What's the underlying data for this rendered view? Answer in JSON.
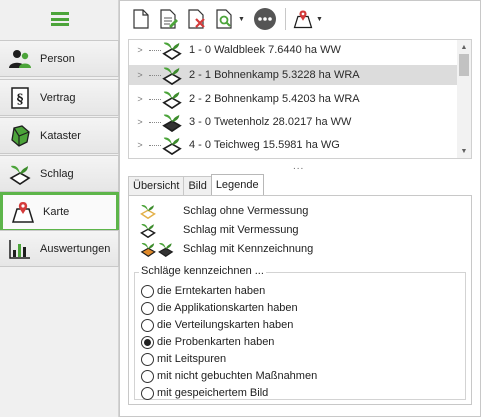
{
  "sidebar": {
    "menu_icon": "hamburger-menu-icon",
    "items": [
      {
        "label": "Person",
        "icon": "person-icon"
      },
      {
        "label": "Vertrag",
        "icon": "contract-icon"
      },
      {
        "label": "Kataster",
        "icon": "cadastre-icon"
      },
      {
        "label": "Schlag",
        "icon": "field-icon"
      },
      {
        "label": "Karte",
        "icon": "map-icon",
        "active": true
      },
      {
        "label": "Auswertungen",
        "icon": "chart-icon"
      }
    ]
  },
  "toolbar": {
    "icons": [
      "new-document-icon",
      "edit-document-icon",
      "delete-document-icon",
      "search-document-icon",
      "more-icon",
      "map-marker-icon"
    ]
  },
  "tree": {
    "rows": [
      {
        "label": "1 - 0 Waldbleek 7.6440 ha WW",
        "selected": false
      },
      {
        "label": "2 - 1 Bohnenkamp 5.3228 ha WRA",
        "selected": true
      },
      {
        "label": "2 - 2 Bohnenkamp 5.4203 ha WRA",
        "selected": false
      },
      {
        "label": "3 - 0 Twetenholz 28.0217 ha WW",
        "selected": false
      },
      {
        "label": "4 - 0 Teichweg 15.5981 ha WG",
        "selected": false
      }
    ]
  },
  "splitter": "...",
  "tabs": [
    {
      "label": "Übersicht",
      "active": false
    },
    {
      "label": "Bild",
      "active": false
    },
    {
      "label": "Legende",
      "active": true
    }
  ],
  "legend": {
    "items": [
      {
        "label": "Schlag ohne Vermessung"
      },
      {
        "label": "Schlag mit Vermessung"
      },
      {
        "label": "Schlag mit Kennzeichnung"
      }
    ],
    "group_title": "Schläge kennzeichnen ...",
    "options": [
      {
        "label": "die Erntekarten haben",
        "checked": false
      },
      {
        "label": "die Applikationskarten haben",
        "checked": false
      },
      {
        "label": "die Verteilungskarten haben",
        "checked": false
      },
      {
        "label": "die Probenkarten haben",
        "checked": true
      },
      {
        "label": "mit Leitspuren",
        "checked": false
      },
      {
        "label": "mit nicht gebuchten Maßnahmen",
        "checked": false
      },
      {
        "label": "mit gespeichertem Bild",
        "checked": false
      }
    ]
  },
  "colors": {
    "accent": "#5db54a",
    "selected_row": "#dcdcdc"
  }
}
